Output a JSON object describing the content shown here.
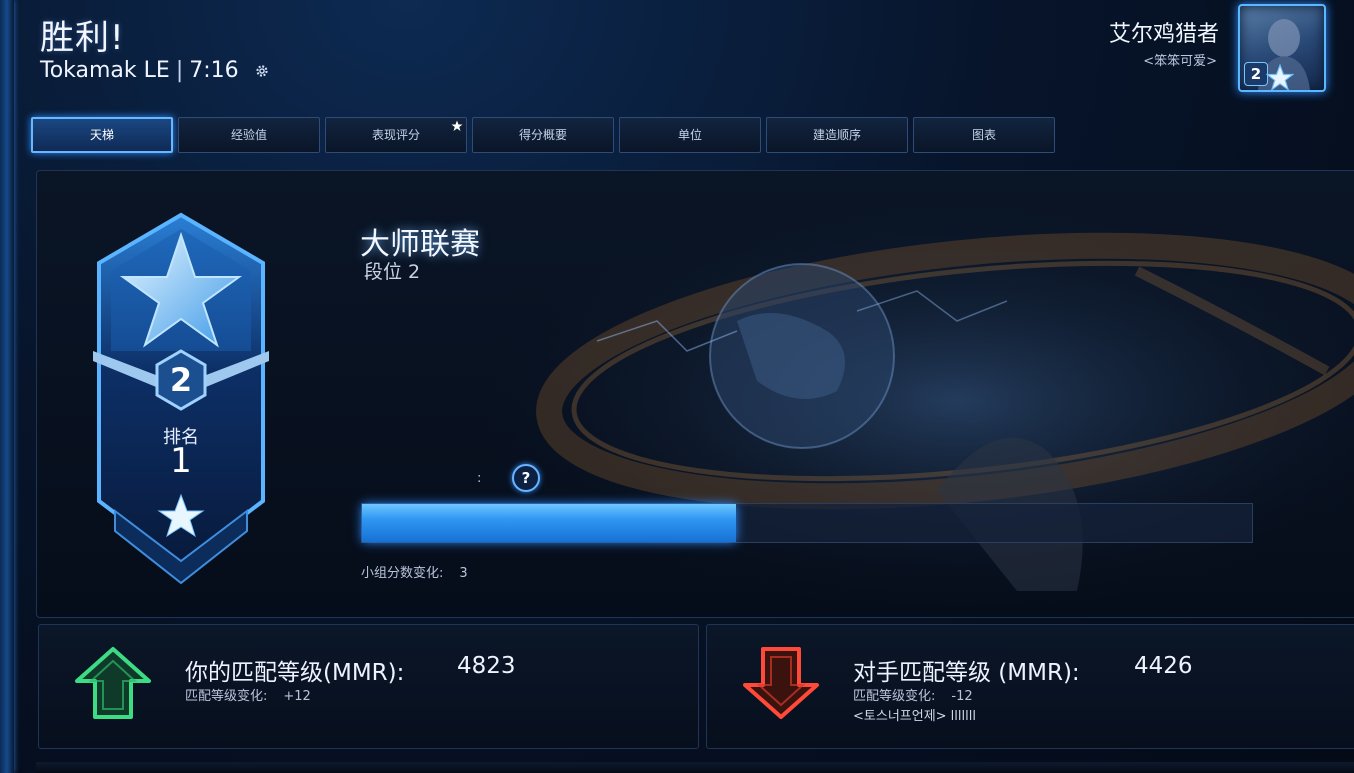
{
  "header": {
    "result": "胜利!",
    "map_name": "Tokamak LE",
    "separator": "|",
    "duration": "7:16"
  },
  "player": {
    "name": "艾尔鸡猎者",
    "clan": "<笨笨可爱>",
    "portrait_rank": "2"
  },
  "tabs": [
    {
      "label": "天梯",
      "active": true
    },
    {
      "label": "经验值"
    },
    {
      "label": "表现评分",
      "starred": true
    },
    {
      "label": "得分概要"
    },
    {
      "label": "单位"
    },
    {
      "label": "建造顺序"
    },
    {
      "label": "图表"
    }
  ],
  "ladder": {
    "league": "大师联赛",
    "tier": "段位 2",
    "rank_label": "排名",
    "rank_value": "1",
    "badge_tier": "2",
    "points_colon": ":",
    "help_label": "?",
    "progress_fraction": 0.42,
    "group_change_label": "小组分数变化:",
    "group_change_value": "3"
  },
  "mmr_you": {
    "title": "你的匹配等级(MMR):",
    "value": "4823",
    "change_label": "匹配等级变化:",
    "change_value": "+12"
  },
  "mmr_opponent": {
    "title": "对手匹配等级 (MMR):",
    "value": "4426",
    "change_label": "匹配等级变化:",
    "change_value": "-12",
    "opponent_name": "<토스너프언제> lllllll"
  },
  "colors": {
    "accent_blue": "#2f97f2",
    "up_green": "#3ddc84",
    "down_red": "#ff4a3a"
  },
  "icons": {
    "settings": "gear-icon",
    "rank_up": "arrow-up-icon",
    "rank_down": "arrow-down-icon",
    "help": "help-icon"
  }
}
